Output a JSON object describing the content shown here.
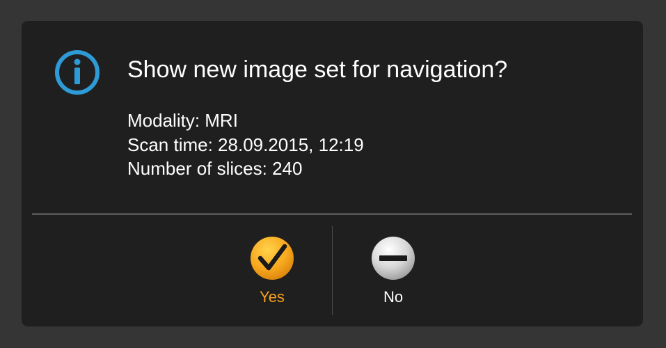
{
  "dialog": {
    "title": "Show new image set for navigation?",
    "details": [
      "Modality: MRI",
      "Scan time: 28.09.2015, 12:19",
      "Number of slices: 240"
    ],
    "icon": "info-icon",
    "buttons": {
      "yes": {
        "label": "Yes",
        "icon": "checkmark-icon",
        "color": "#f5a21c"
      },
      "no": {
        "label": "No",
        "icon": "minus-icon",
        "color": "#ffffff"
      }
    }
  },
  "colors": {
    "background": "#353535",
    "dialog": "#1f1f1f",
    "info_accent": "#2e9bd6",
    "yes_accent": "#f5a21c"
  }
}
